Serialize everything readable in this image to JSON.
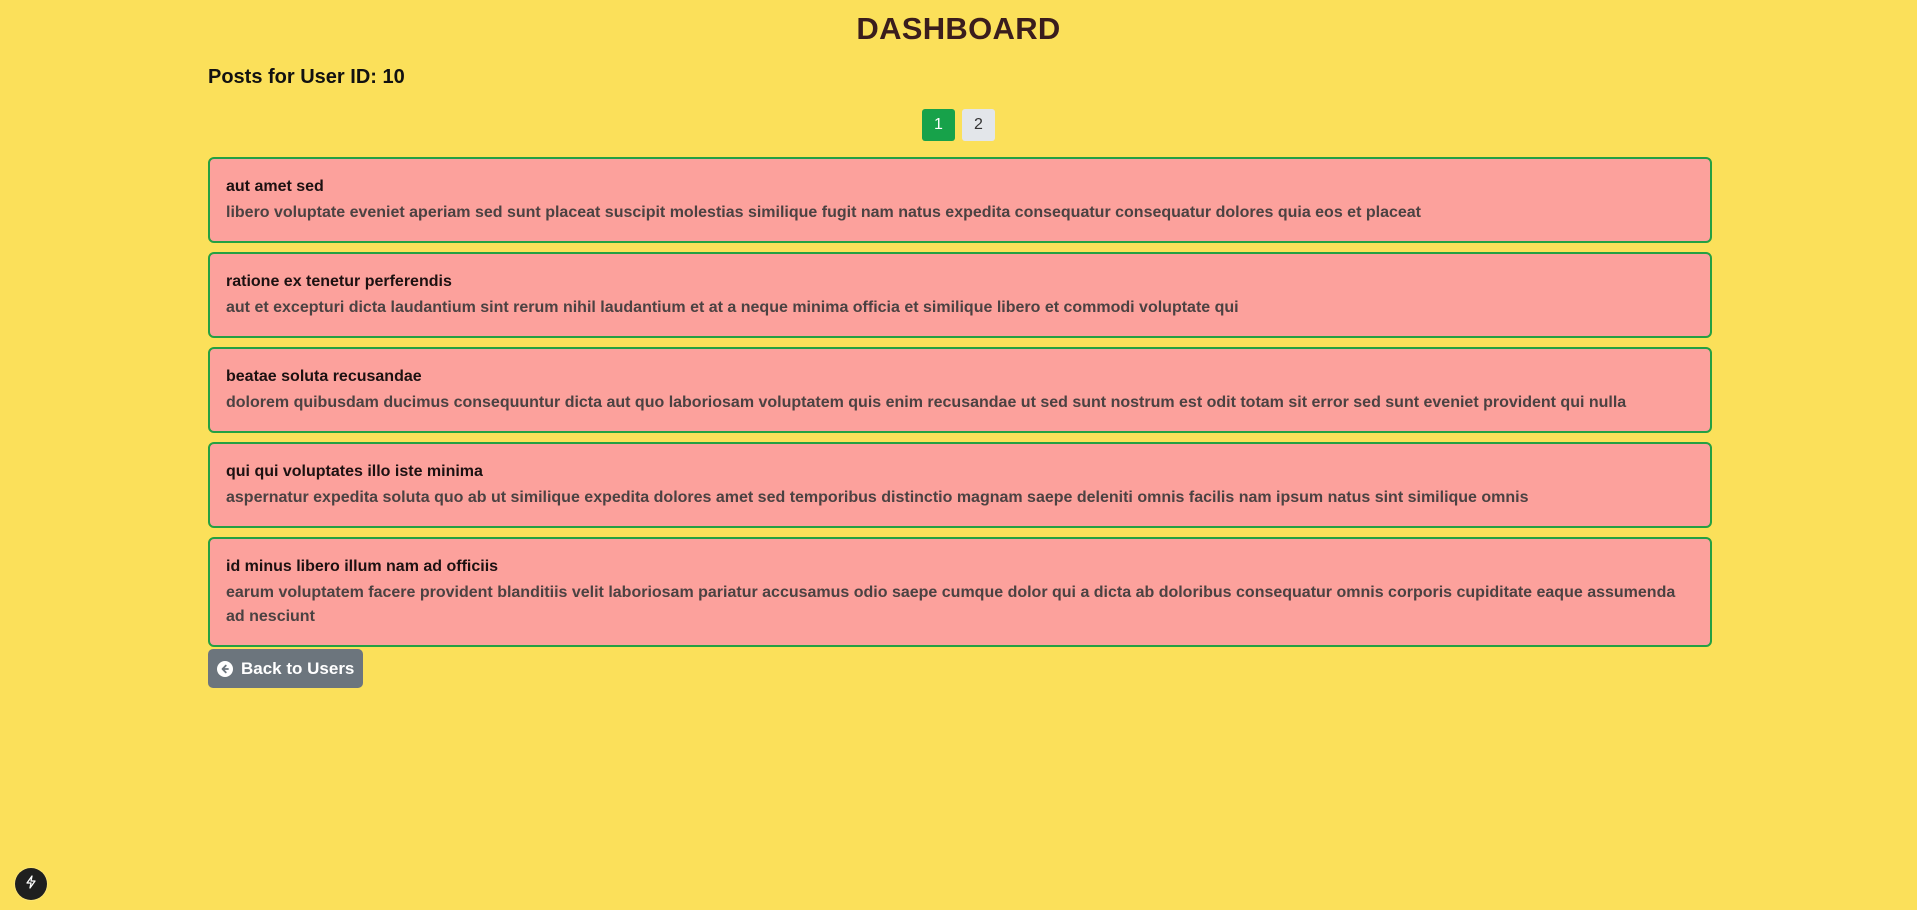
{
  "header": {
    "title": "DASHBOARD"
  },
  "section": {
    "heading": "Posts for User ID: 10"
  },
  "pagination": {
    "pages": [
      "1",
      "2"
    ],
    "active_page": "1"
  },
  "posts": [
    {
      "title": "aut amet sed",
      "body": "libero voluptate eveniet aperiam sed sunt placeat suscipit molestias similique fugit nam natus expedita consequatur consequatur dolores quia eos et placeat"
    },
    {
      "title": "ratione ex tenetur perferendis",
      "body": "aut et excepturi dicta laudantium sint rerum nihil laudantium et at a neque minima officia et similique libero et commodi voluptate qui"
    },
    {
      "title": "beatae soluta recusandae",
      "body": "dolorem quibusdam ducimus consequuntur dicta aut quo laboriosam voluptatem quis enim recusandae ut sed sunt nostrum est odit totam sit error sed sunt eveniet provident qui nulla"
    },
    {
      "title": "qui qui voluptates illo iste minima",
      "body": "aspernatur expedita soluta quo ab ut similique expedita dolores amet sed temporibus distinctio magnam saepe deleniti omnis facilis nam ipsum natus sint similique omnis"
    },
    {
      "title": "id minus libero illum nam ad officiis",
      "body": "earum voluptatem facere provident blanditiis velit laboriosam pariatur accusamus odio saepe cumque dolor qui a dicta ab doloribus consequatur omnis corporis cupiditate eaque assumenda ad nesciunt"
    }
  ],
  "actions": {
    "back_label": "Back to Users",
    "back_icon": "arrow-left-circle-icon"
  },
  "dev_badge": {
    "icon": "lightning-icon"
  },
  "colors": {
    "background": "#fbe05a",
    "card_background": "#fca19c",
    "card_border": "#24a043",
    "active_page": "#17a24a",
    "inactive_page": "#e3e6ea",
    "back_button": "#6c757d"
  }
}
